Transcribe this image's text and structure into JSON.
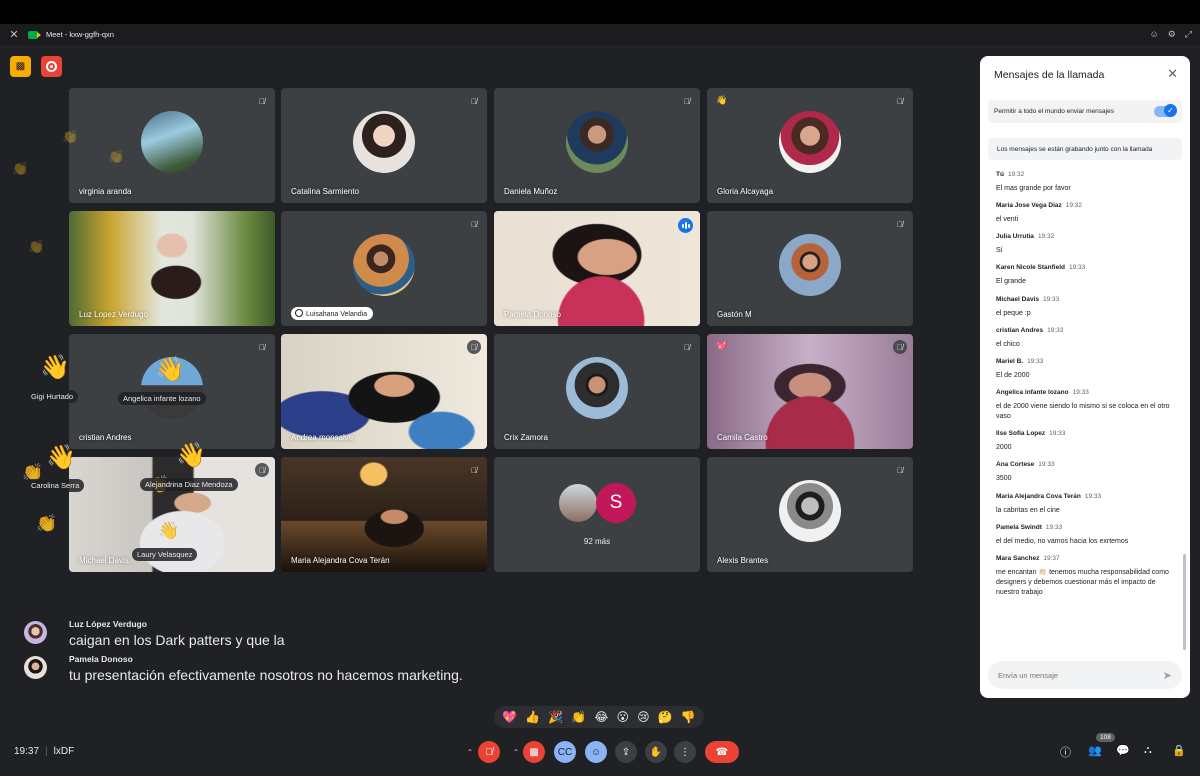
{
  "window": {
    "title": "Meet - kxw-ggfh-qxn"
  },
  "tiles": [
    {
      "name": "virginia aranda"
    },
    {
      "name": "Catalina Sarmiento"
    },
    {
      "name": "Daniela Muñoz"
    },
    {
      "name": "Gloria Alcayaga"
    },
    {
      "name": "Luz Lopez Verdugo"
    },
    {
      "name": "Luisahana Velandia"
    },
    {
      "name": "Pamela Donoso"
    },
    {
      "name": "Gastón M"
    },
    {
      "name": "cristian Andres"
    },
    {
      "name": "Andrea monsalve"
    },
    {
      "name": "Crix Zamora"
    },
    {
      "name": "Camila Castro"
    },
    {
      "name": "Michael Davis"
    },
    {
      "name": "Maria Alejandra Cova Terán"
    },
    {
      "name": "92 más",
      "avatar_letter": "S"
    },
    {
      "name": "Alexis Brantes"
    }
  ],
  "reaction_names": [
    "Gigi Hurtado",
    "Angelica infante lozano",
    "Carolina Serra",
    "Alejandrina Diaz Mendoza",
    "Laury Velasquez"
  ],
  "captions": [
    {
      "speaker": "Luz López Verdugo",
      "text": "caigan en los Dark patters y que la"
    },
    {
      "speaker": "Pamela Donoso",
      "text": "tu presentación efectivamente nosotros no hacemos marketing."
    }
  ],
  "reactions_bar": [
    "💖",
    "👍",
    "🎉",
    "👏",
    "😂",
    "😮",
    "😢",
    "🤔",
    "👎"
  ],
  "bottom": {
    "time": "19:37",
    "meeting_code": "lxDF",
    "participants_count": "108"
  },
  "chat": {
    "title": "Mensajes de la llamada",
    "allow_label": "Permitir a todo el mundo enviar mensajes",
    "notice": "Los mensajes se están grabando junto con la llamada",
    "input_placeholder": "Envía un mensaje",
    "messages": [
      {
        "sender": "Tú",
        "time": "19:32",
        "text": "El mas grande por favor"
      },
      {
        "sender": "Maria Jose Vega Diaz",
        "time": "19:32",
        "text": "el venti"
      },
      {
        "sender": "Julia Urrutia",
        "time": "19:32",
        "text": "Sí"
      },
      {
        "sender": "Karen Nicole Stanfield",
        "time": "19:33",
        "text": "El grande"
      },
      {
        "sender": "Michael Davis",
        "time": "19:33",
        "text": "el peque :p"
      },
      {
        "sender": "cristian Andres",
        "time": "19:33",
        "text": "el chico"
      },
      {
        "sender": "Mariel B.",
        "time": "19:33",
        "text": "El de 2000"
      },
      {
        "sender": "Angelica infante lozano",
        "time": "19:33",
        "text": "el de 2000 viene siendo lo mismo si se coloca en el otro vaso"
      },
      {
        "sender": "Ilse Sofia Lopez",
        "time": "19:33",
        "text": "2000"
      },
      {
        "sender": "Ana Cortese",
        "time": "19:33",
        "text": "3500"
      },
      {
        "sender": "Maria Alejandra Cova Terán",
        "time": "19:33",
        "text": "la cabritas en el cine"
      },
      {
        "sender": "Pamela Swindt",
        "time": "19:33",
        "text": "el del medio, no vamos hacia los exrtemos"
      },
      {
        "sender": "Mara Sanchez",
        "time": "19:37",
        "text": "me encantan 👏🏻 tenemos mucha responsabilidad como designers y debemos cuestionar más el impacto de nuestro trabajo"
      }
    ]
  },
  "colors": {
    "background": "#202124",
    "tile": "#3c4043",
    "accent": "#1a73e8",
    "danger": "#ea4335",
    "record_badge": "#f9ab00"
  }
}
